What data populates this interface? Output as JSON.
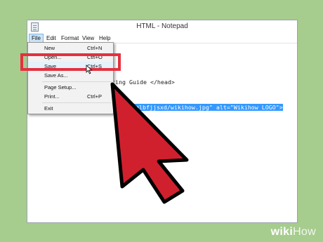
{
  "window": {
    "title": "HTML - Notepad"
  },
  "menubar": {
    "items": [
      {
        "label": "File"
      },
      {
        "label": "Edit"
      },
      {
        "label": "Format"
      },
      {
        "label": "View"
      },
      {
        "label": "Help"
      }
    ]
  },
  "editor": {
    "visible_fragment_1": "ting Guide </head>",
    "visible_fragment_2": "t.org/glbfjjsxd/wikihow.jpg\" alt=\"Wikihow LOGO\">"
  },
  "file_menu": {
    "items": [
      {
        "label": "New",
        "shortcut": "Ctrl+N"
      },
      {
        "label": "Open...",
        "shortcut": "Ctrl+O"
      },
      {
        "label": "Save",
        "shortcut": "Ctrl+S"
      },
      {
        "label": "Save As...",
        "shortcut": ""
      },
      {
        "label": "Page Setup...",
        "shortcut": ""
      },
      {
        "label": "Print...",
        "shortcut": "Ctrl+P"
      },
      {
        "label": "Exit",
        "shortcut": ""
      }
    ]
  },
  "annotation": {
    "highlight_color": "#e4303f",
    "arrow_color": "#d0202e"
  },
  "watermark": {
    "part1": "wiki",
    "part2": "How"
  }
}
